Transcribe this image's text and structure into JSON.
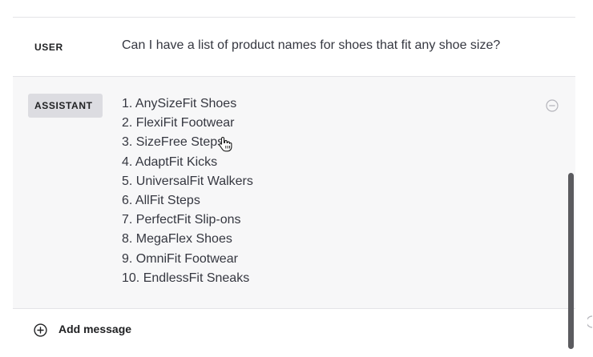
{
  "user_row": {
    "role": "USER",
    "message": "Can I have a list of product names for shoes that fit any shoe size?"
  },
  "assistant_row": {
    "role": "ASSISTANT",
    "items": [
      "1. AnySizeFit Shoes",
      "2. FlexiFit Footwear",
      "3. SizeFree Steps",
      "4. AdaptFit Kicks",
      "5. UniversalFit Walkers",
      "6. AllFit Steps",
      "7. PerfectFit Slip-ons",
      "8. MegaFlex Shoes",
      "9. OmniFit Footwear",
      "10. EndlessFit Sneaks"
    ],
    "remove_icon": "minus-circle-icon"
  },
  "add_message": {
    "label": "Add message",
    "icon": "plus-circle-icon"
  },
  "colors": {
    "assistant_background": "#f7f7f8",
    "badge_background": "#dcdce1",
    "divider": "#e4e4e7",
    "text": "#353740",
    "scrollbar": "#5b5b5f"
  }
}
